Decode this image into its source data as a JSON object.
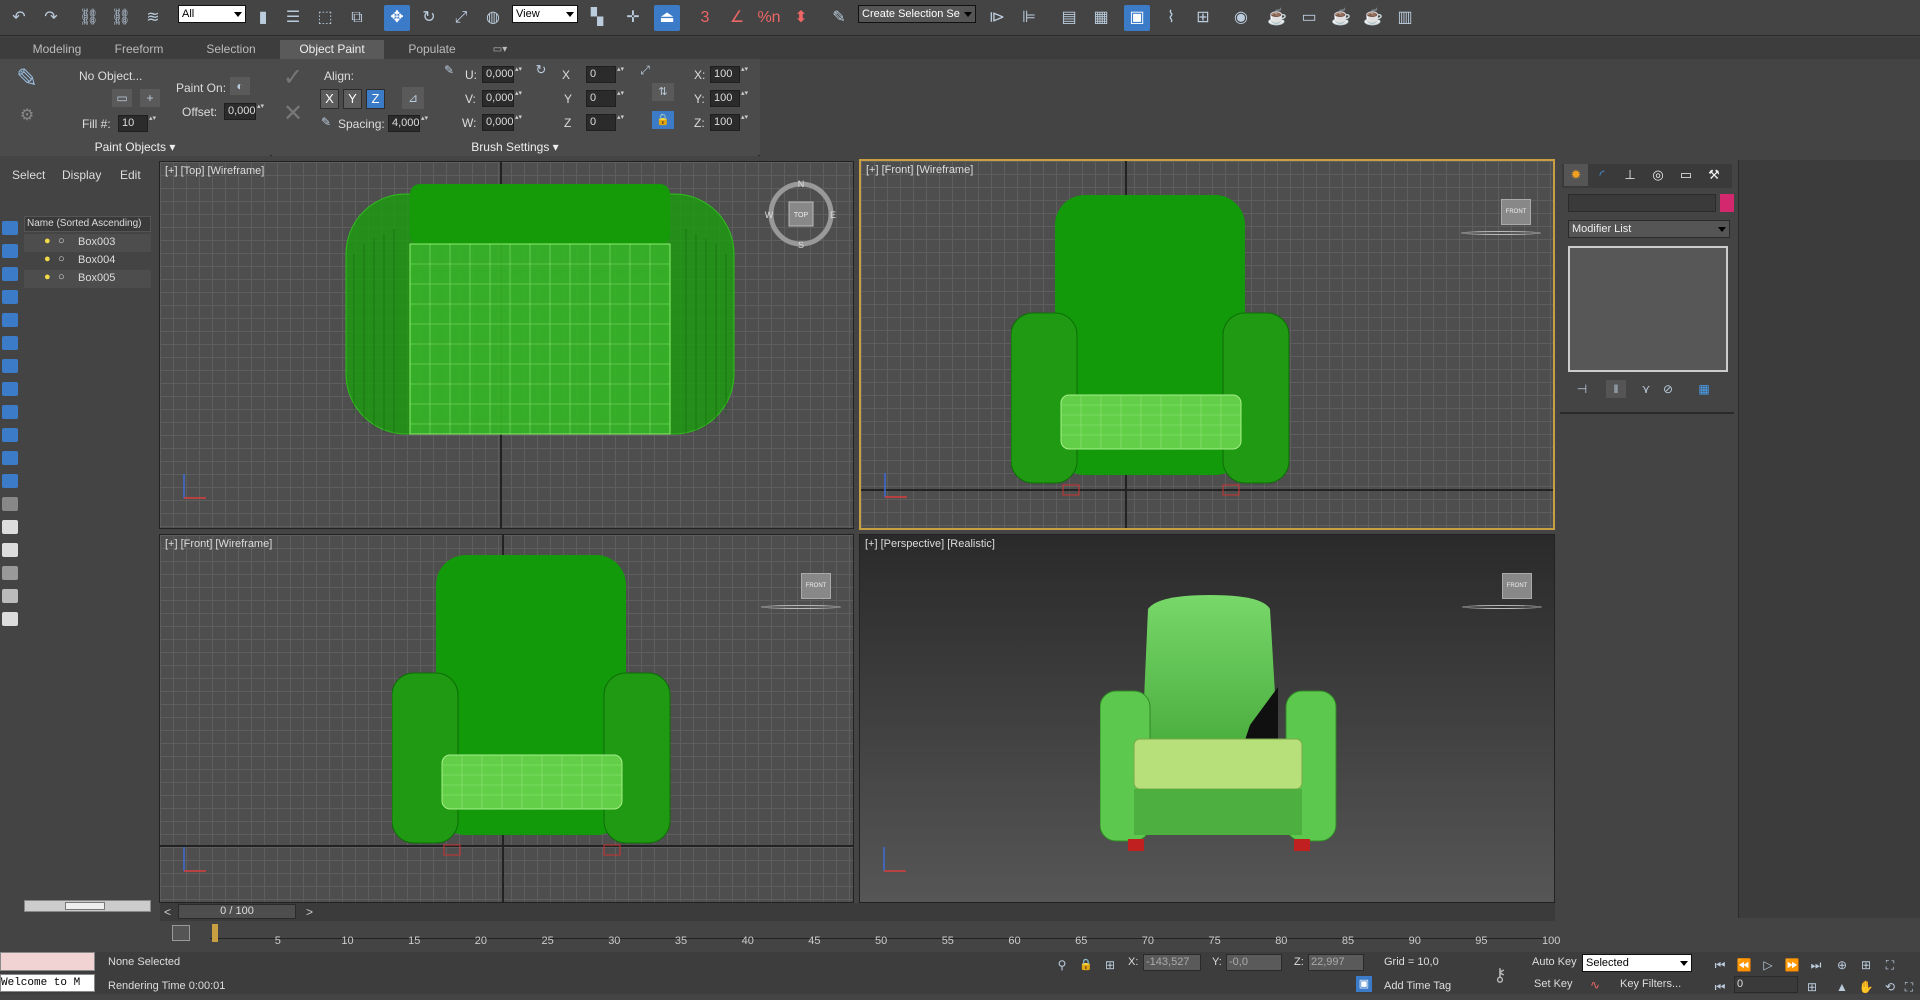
{
  "toolbar": {
    "filter_value": "All",
    "ref_coord_value": "View",
    "selection_set_value": "Create Selection Se",
    "snap_label": "3",
    "percent_snap": "%n"
  },
  "ribbon": {
    "tabs": [
      "Modeling",
      "Freeform",
      "Selection",
      "Object Paint",
      "Populate"
    ],
    "active_tab": "Object Paint",
    "no_object": "No Object...",
    "paint_on": "Paint On:",
    "offset_label": "Offset:",
    "offset_value": "0,000",
    "fill_label": "Fill #:",
    "fill_value": "10",
    "align_label": "Align:",
    "axis_x": "X",
    "axis_y": "Y",
    "axis_z": "Z",
    "spacing_label": "Spacing:",
    "spacing_value": "4,000",
    "u_label": "U:",
    "u_value": "0,000",
    "v_label": "V:",
    "v_value": "0,000",
    "w_label": "W:",
    "w_value": "0,000",
    "rx_label": "X",
    "rx_value": "0",
    "ry_label": "Y",
    "ry_value": "0",
    "rz_label": "Z",
    "rz_value": "0",
    "sx_label": "X:",
    "sx_value": "100",
    "sy_label": "Y:",
    "sy_value": "100",
    "sz_label": "Z:",
    "sz_value": "100",
    "group_paint_objects": "Paint Objects",
    "group_brush_settings": "Brush Settings"
  },
  "scene_explorer": {
    "menus": [
      "Select",
      "Display",
      "Edit"
    ],
    "column_header": "Name (Sorted Ascending)",
    "items": [
      "Box003",
      "Box004",
      "Box005"
    ]
  },
  "viewports": {
    "top_label": "[+] [Top] [Wireframe]",
    "front_label": "[+] [Front] [Wireframe]",
    "front2_label": "[+] [Front] [Wireframe]",
    "persp_label": "[+] [Perspective] [Realistic]",
    "compass_n": "N",
    "compass_s": "S",
    "compass_e": "E",
    "compass_w": "W",
    "cube_top": "TOP",
    "cube_front": "FRONT"
  },
  "command_panel": {
    "modifier_list": "Modifier List",
    "color_swatch": "#d4286e"
  },
  "timeline": {
    "frame_counter": "0 / 100",
    "ticks": [
      "5",
      "10",
      "15",
      "20",
      "25",
      "30",
      "35",
      "40",
      "45",
      "50",
      "55",
      "60",
      "65",
      "70",
      "75",
      "80",
      "85",
      "90",
      "95",
      "100"
    ]
  },
  "status": {
    "selection": "None Selected",
    "rendering_time": "Rendering Time  0:00:01",
    "x_label": "X:",
    "x_value": "-143,527",
    "y_label": "Y:",
    "y_value": "-0,0",
    "z_label": "Z:",
    "z_value": "22,997",
    "grid": "Grid = 10,0",
    "add_time_tag": "Add Time Tag",
    "auto_key": "Auto Key",
    "set_key": "Set Key",
    "key_mode": "Selected",
    "key_filters": "Key Filters...",
    "frame_value": "0",
    "script": "Welcome to M"
  },
  "colors": {
    "accent": "#3b7bc8",
    "active_viewport": "#c8a042",
    "wire_green": "#1f9a12",
    "chair_green": "#6fcf5e"
  }
}
